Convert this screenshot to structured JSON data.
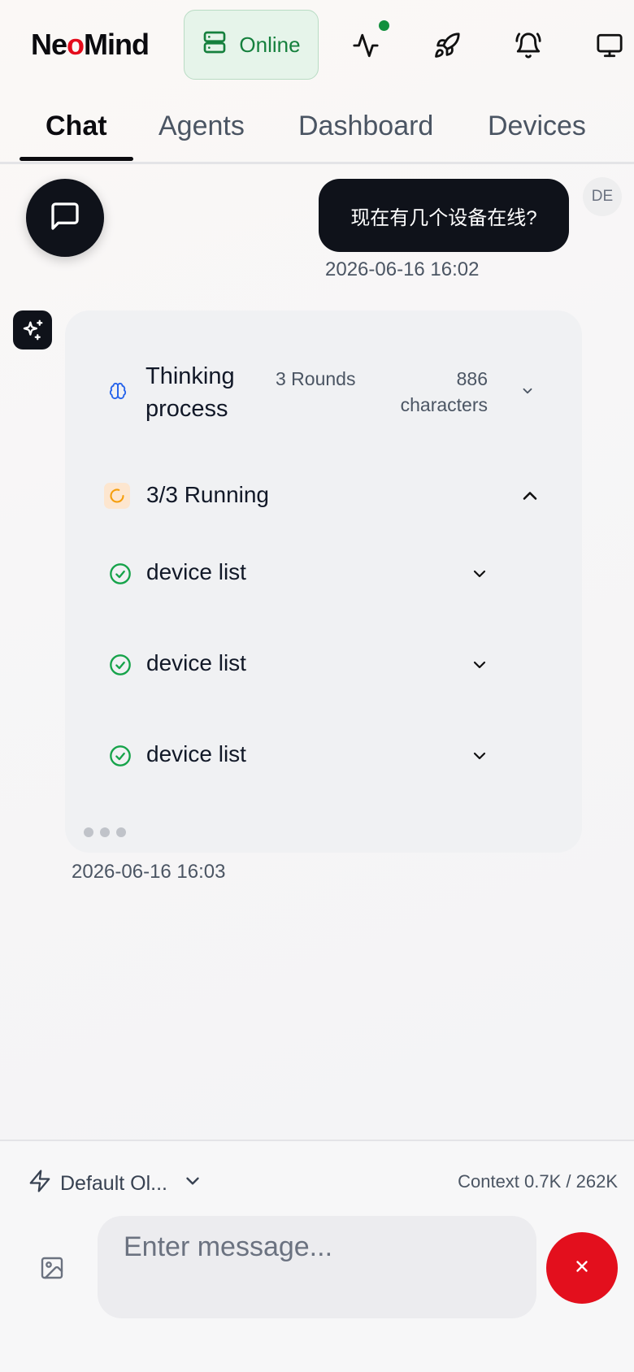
{
  "header": {
    "logo_prefix": "Ne",
    "logo_o": "o",
    "logo_suffix": "Mind",
    "status_label": "Online",
    "icons": [
      "server-icon",
      "activity-icon",
      "rocket-icon",
      "bell-icon",
      "monitor-icon"
    ],
    "status_color": "#15803d",
    "brand_color": "#e40b1b"
  },
  "tabs": [
    {
      "label": "Chat",
      "active": true
    },
    {
      "label": "Agents",
      "active": false
    },
    {
      "label": "Dashboard",
      "active": false
    },
    {
      "label": "Devices",
      "active": false
    }
  ],
  "chat": {
    "user_message": "现在有几个设备在线?",
    "user_avatar": "DE",
    "user_timestamp": "2026-06-16 16:02",
    "ai_timestamp": "2026-06-16 16:03",
    "thinking": {
      "title": "Thinking process",
      "rounds": "3 Rounds",
      "characters": "886 characters"
    },
    "running": {
      "label": "3/3 Running",
      "tools": [
        {
          "label": "device list",
          "status": "done"
        },
        {
          "label": "device list",
          "status": "done"
        },
        {
          "label": "device list",
          "status": "done"
        }
      ]
    }
  },
  "composer": {
    "model_label": "Default Ol...",
    "context": "Context 0.7K / 262K",
    "placeholder": "Enter message...",
    "stop_color": "#e30f1d"
  }
}
